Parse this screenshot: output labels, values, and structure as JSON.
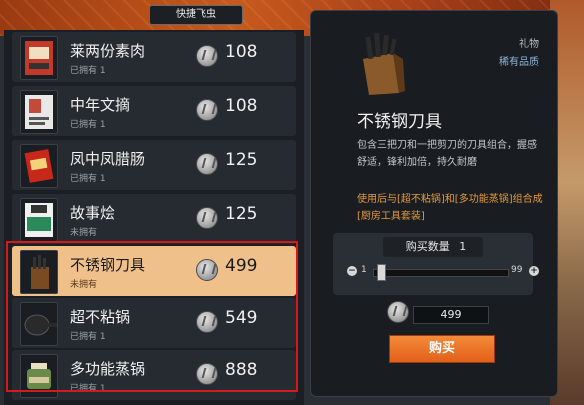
{
  "header": {
    "title": "快捷飞虫"
  },
  "shop_items": [
    {
      "name": "莱两份素肉",
      "status": "已拥有 1",
      "price": "108"
    },
    {
      "name": "中年文摘",
      "status": "已拥有 1",
      "price": "108"
    },
    {
      "name": "凤中凤腊肠",
      "status": "已拥有 1",
      "price": "125"
    },
    {
      "name": "故事烩",
      "status": "未拥有",
      "price": "125"
    },
    {
      "name": "不锈钢刀具",
      "status": "未拥有",
      "price": "499"
    },
    {
      "name": "超不粘锅",
      "status": "已拥有 1",
      "price": "549"
    },
    {
      "name": "多功能蒸锅",
      "status": "已拥有 1",
      "price": "888"
    }
  ],
  "detail": {
    "category": "礼物",
    "rarity": "稀有品质",
    "title": "不锈钢刀具",
    "description": "包含三把刀和一把剪刀的刀具组合，握感舒适，锋利加倍，持久耐磨",
    "usage": "使用后与[超不粘锅]和[多功能蒸锅]组合成[厨房工具套装]",
    "quantity_label": "购买数量",
    "quantity": "1",
    "min": "1",
    "max": "99",
    "total": "499",
    "buy_label": "购买"
  },
  "colors": {
    "accent": "#e2601a",
    "selected_bg": "#f0c08a",
    "highlight_border": "#d41a1a",
    "usage_text": "#e59a3c"
  }
}
